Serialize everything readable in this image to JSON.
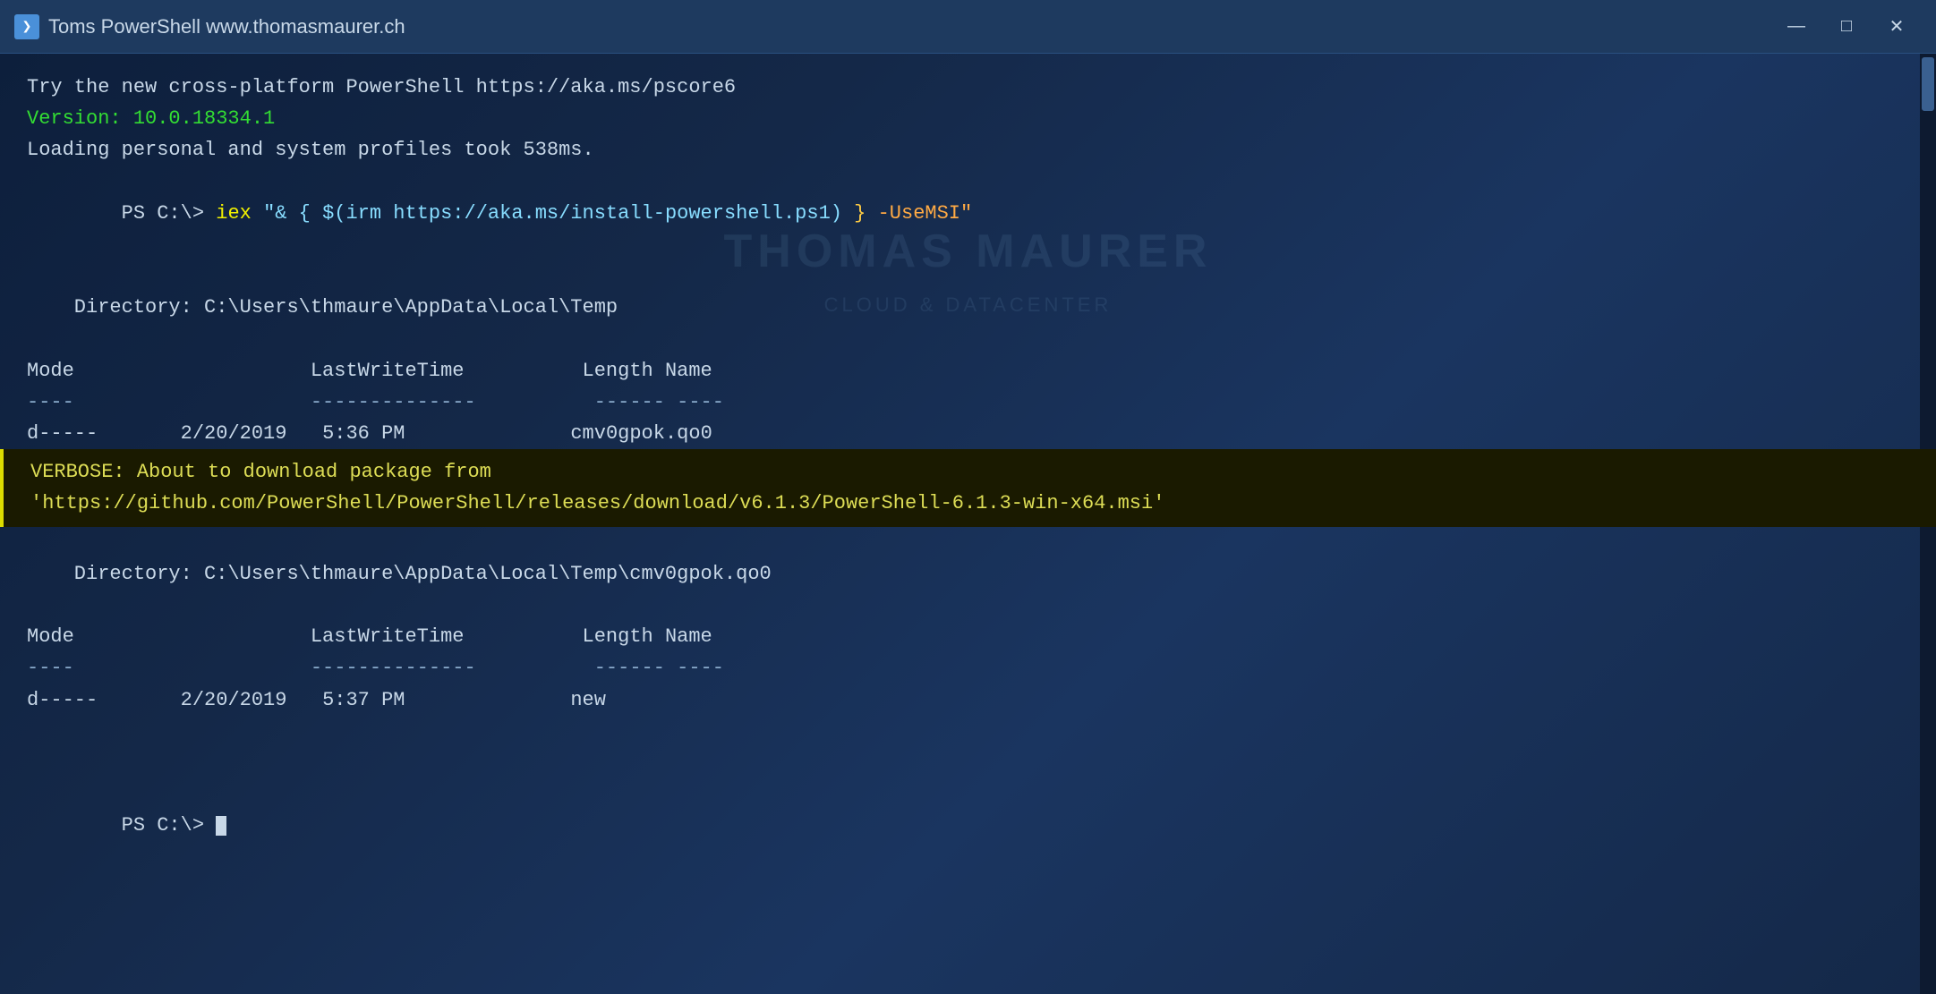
{
  "window": {
    "title": "Toms PowerShell www.thomasmaurer.ch",
    "icon_label": "PS"
  },
  "title_buttons": {
    "minimize": "—",
    "maximize": "□",
    "close": "✕"
  },
  "terminal": {
    "line1": "Try the new cross-platform PowerShell https://aka.ms/pscore6",
    "line_version_label": "Version: 10.0.18334.1",
    "line_loading": "Loading personal and system profiles took 538ms.",
    "prompt1": "PS C:\\> ",
    "cmd_iex": "iex",
    "cmd_space": " ",
    "cmd_string_open": "\"& { ",
    "cmd_irm": "$(irm https://aka.ms/install-powershell.ps1)",
    "cmd_string_close": " }",
    "cmd_param": " -UseMSI\"",
    "blank1": "",
    "dir_label1": "    Directory: C:\\Users\\thmaure\\AppData\\Local\\Temp",
    "blank2": "",
    "col_mode": "Mode",
    "col_lwt": "LastWriteTime",
    "col_length": "Length",
    "col_name": "Name",
    "sep_mode": "----",
    "sep_lwt": "--------------",
    "sep_length": "------",
    "sep_name": "----",
    "row1_mode": "d-----",
    "row1_date": "2/20/2019",
    "row1_time": "5:36 PM",
    "row1_length": "",
    "row1_name": "cmv0gpok.qo0",
    "verbose_line1": "VERBOSE: About to download package from",
    "verbose_line2": "'https://github.com/PowerShell/PowerShell/releases/download/v6.1.3/PowerShell-6.1.3-win-x64.msi'",
    "blank3": "",
    "dir_label2": "    Directory: C:\\Users\\thmaure\\AppData\\Local\\Temp\\cmv0gpok.qo0",
    "blank4": "",
    "col2_mode": "Mode",
    "col2_lwt": "LastWriteTime",
    "col2_length": "Length",
    "col2_name": "Name",
    "sep2_mode": "----",
    "sep2_lwt": "--------------",
    "sep2_length": "------",
    "sep2_name": "----",
    "row2_mode": "d-----",
    "row2_date": "2/20/2019",
    "row2_time": "5:37 PM",
    "row2_length": "",
    "row2_name": "new",
    "blank5": "",
    "blank6": "",
    "prompt2": "PS C:\\> ",
    "watermark_line1": "THOMAS MAURER",
    "watermark_line2": "CLOUD & DATACENTER"
  }
}
